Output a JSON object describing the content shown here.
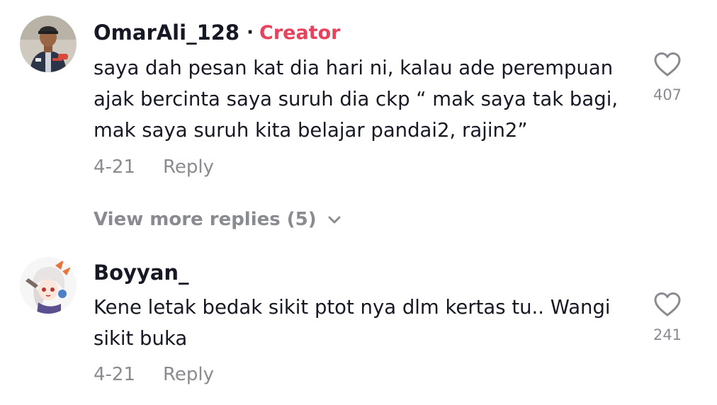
{
  "comments": [
    {
      "username": "OmarAli_128",
      "separator": "·",
      "badge": "Creator",
      "text": "saya dah pesan kat dia hari ni, kalau ade perempuan ajak bercinta saya suruh dia ckp “ mak saya tak bagi, mak saya suruh kita belajar pandai2, rajin2”",
      "date": "4-21",
      "reply_label": "Reply",
      "likes": "407",
      "avatar_icon": "user-photo-avatar"
    },
    {
      "username": "Boyyan_",
      "text": "Kene letak bedak sikit ptot nya dlm kertas tu.. Wangi sikit buka",
      "date": "4-21",
      "reply_label": "Reply",
      "likes": "241",
      "avatar_icon": "anime-character-avatar"
    }
  ],
  "view_more_replies": "View more replies (5)",
  "colors": {
    "text_primary": "#161823",
    "text_secondary": "#8a8b91",
    "creator_accent": "#e8435c"
  }
}
